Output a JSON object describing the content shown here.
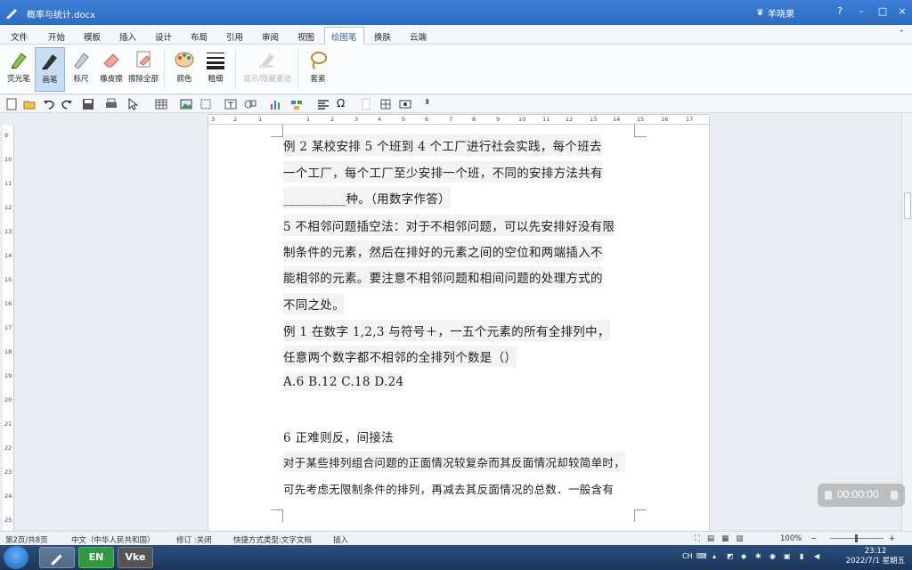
{
  "window": {
    "title": "概率与统计.docx",
    "user": "羊晓果",
    "buttons": [
      "?",
      "-",
      "□",
      "×"
    ]
  },
  "tabs": [
    "文件",
    "开始",
    "模板",
    "插入",
    "设计",
    "布局",
    "引用",
    "审阅",
    "视图",
    "绘图笔",
    "换肤",
    "云端"
  ],
  "active_tab": "绘图笔",
  "ribbon": {
    "highlighter": "荧光笔",
    "pen": "画笔",
    "ruler": "标尺",
    "eraser": "橡皮擦",
    "erase_all": "擦除全部",
    "color": "颜色",
    "thickness": "粗细",
    "show_hide": "显示/隐藏墨迹",
    "lasso": "套索"
  },
  "ruler": {
    "horizontal": [
      "3",
      "2",
      "1",
      "1",
      "2",
      "3",
      "4",
      "5",
      "6",
      "7",
      "8",
      "9",
      "10",
      "11",
      "12",
      "13",
      "14",
      "15",
      "16",
      "17"
    ],
    "vertical": [
      "9",
      "10",
      "11",
      "12",
      "13",
      "14",
      "15",
      "16",
      "17",
      "18",
      "19",
      "20",
      "21",
      "22",
      "23",
      "24",
      "25"
    ]
  },
  "document": {
    "lines": [
      "例 2   某校安排 5 个班到 4 个工厂进行社会实践，每个班去",
      "一个工厂，每个工厂至少安排一个班，不同的安排方法共有",
      "__________种。（用数字作答）",
      "5 不相邻问题插空法：对于不相邻问题，可以先安排好没有限",
      "制条件的元素，然后在排好的元素之间的空位和两端插入不",
      "能相邻的元素。要注意不相邻问题和相间问题的处理方式的",
      "不同之处。",
      "例 1   在数字 1,2,3 与符号＋，一五个元素的所有全排列中，",
      "任意两个数字都不相邻的全排列个数是（）",
      "A.6    B.12   C.18    D.24",
      "6 正难则反，间接法",
      "对于某些排列组合问题的正面情况较复杂而其反面情况却较简单时，",
      "可先考虑无限制条件的排列，再减去其反面情况的总数．一般含有"
    ]
  },
  "recorder": {
    "time": "00:00:00"
  },
  "status": {
    "page": "第2页/共8页",
    "language": "中文（中华人民共和国）",
    "revision": "修订 :关闭",
    "doc_type": "快捷方式类型:文字文档",
    "mode": "插入",
    "zoom": "100%"
  },
  "taskbar": {
    "item_en": "EN",
    "item_vke": "Vke",
    "lang": "CH",
    "time": "23:12",
    "date": "2022/7/1 星期五"
  },
  "colors": {
    "titlebar": "#2d6cc3",
    "active_tab": "#2a63b8",
    "taskbar": "#1b3659"
  }
}
